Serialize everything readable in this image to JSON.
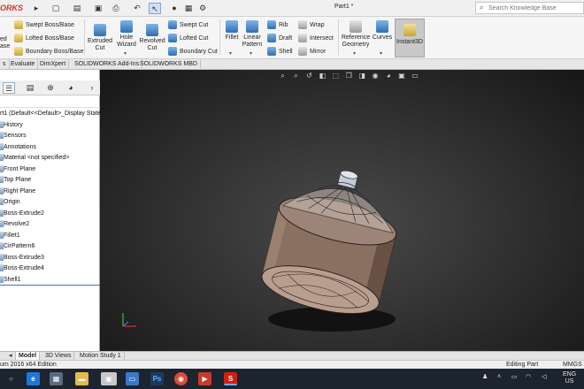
{
  "app": {
    "logo_text": "ORKS",
    "document_title": "Part1 *",
    "search_placeholder": "Search Knowledge Base"
  },
  "ribbon": {
    "features_left": [
      {
        "label": "ed"
      },
      {
        "label": "ase"
      }
    ],
    "boss_group": [
      {
        "label": "Swept Boss/Base"
      },
      {
        "label": "Lofted Boss/Base"
      },
      {
        "label": "Boundary Boss/Base"
      }
    ],
    "extruded_cut": {
      "line1": "Extruded",
      "line2": "Cut"
    },
    "hole_wizard": {
      "line1": "Hole",
      "line2": "Wizard"
    },
    "revolved_cut": {
      "line1": "Revolved",
      "line2": "Cut"
    },
    "cut_group": [
      {
        "label": "Swept Cut"
      },
      {
        "label": "Lofted Cut"
      },
      {
        "label": "Boundary Cut"
      }
    ],
    "fillet": {
      "label": "Fillet"
    },
    "linear_pattern": {
      "line1": "Linear",
      "line2": "Pattern"
    },
    "feature_group": [
      {
        "label": "Rib"
      },
      {
        "label": "Draft"
      },
      {
        "label": "Shell"
      }
    ],
    "feature_group2": [
      {
        "label": "Wrap"
      },
      {
        "label": "Intersect"
      },
      {
        "label": "Mirror"
      }
    ],
    "reference_geometry": {
      "line1": "Reference",
      "line2": "Geometry"
    },
    "curves": {
      "label": "Curves"
    },
    "instant3d": {
      "label": "Instant3D"
    }
  },
  "command_tabs": [
    {
      "label": "s"
    },
    {
      "label": "Evaluate"
    },
    {
      "label": "DimXpert"
    },
    {
      "label": "SOLIDWORKS Add-Ins"
    },
    {
      "label": "SOLIDWORKS MBD"
    }
  ],
  "feature_tree": {
    "root": "rt1  (Default<<Default>_Display State",
    "items": [
      {
        "label": "History"
      },
      {
        "label": "Sensors"
      },
      {
        "label": "Annotations"
      },
      {
        "label": "Material <not specified>"
      },
      {
        "label": "Front Plane"
      },
      {
        "label": "Top Plane"
      },
      {
        "label": "Right Plane"
      },
      {
        "label": "Origin"
      },
      {
        "label": "Boss-Extrude2"
      },
      {
        "label": "Revolve2"
      },
      {
        "label": "Fillet1"
      },
      {
        "label": "CirPattern6"
      },
      {
        "label": "Boss-Extrude3"
      },
      {
        "label": "Boss-Extrude4"
      },
      {
        "label": "Shell1"
      }
    ]
  },
  "bottom_tabs": [
    {
      "label": "Model"
    },
    {
      "label": "3D Views"
    },
    {
      "label": "Motion Study 1"
    }
  ],
  "status_bar": {
    "edition": "um 2016 x64 Edition",
    "mode": "Editing Part",
    "units": "MMGS"
  },
  "taskbar": {
    "language_line1": "ENG",
    "language_line2": "US",
    "photoshop_label": "Ps"
  },
  "colors": {
    "accent": "#e03020",
    "viewport_bg": "#2e2e2e",
    "part_body": "#8a7060"
  }
}
